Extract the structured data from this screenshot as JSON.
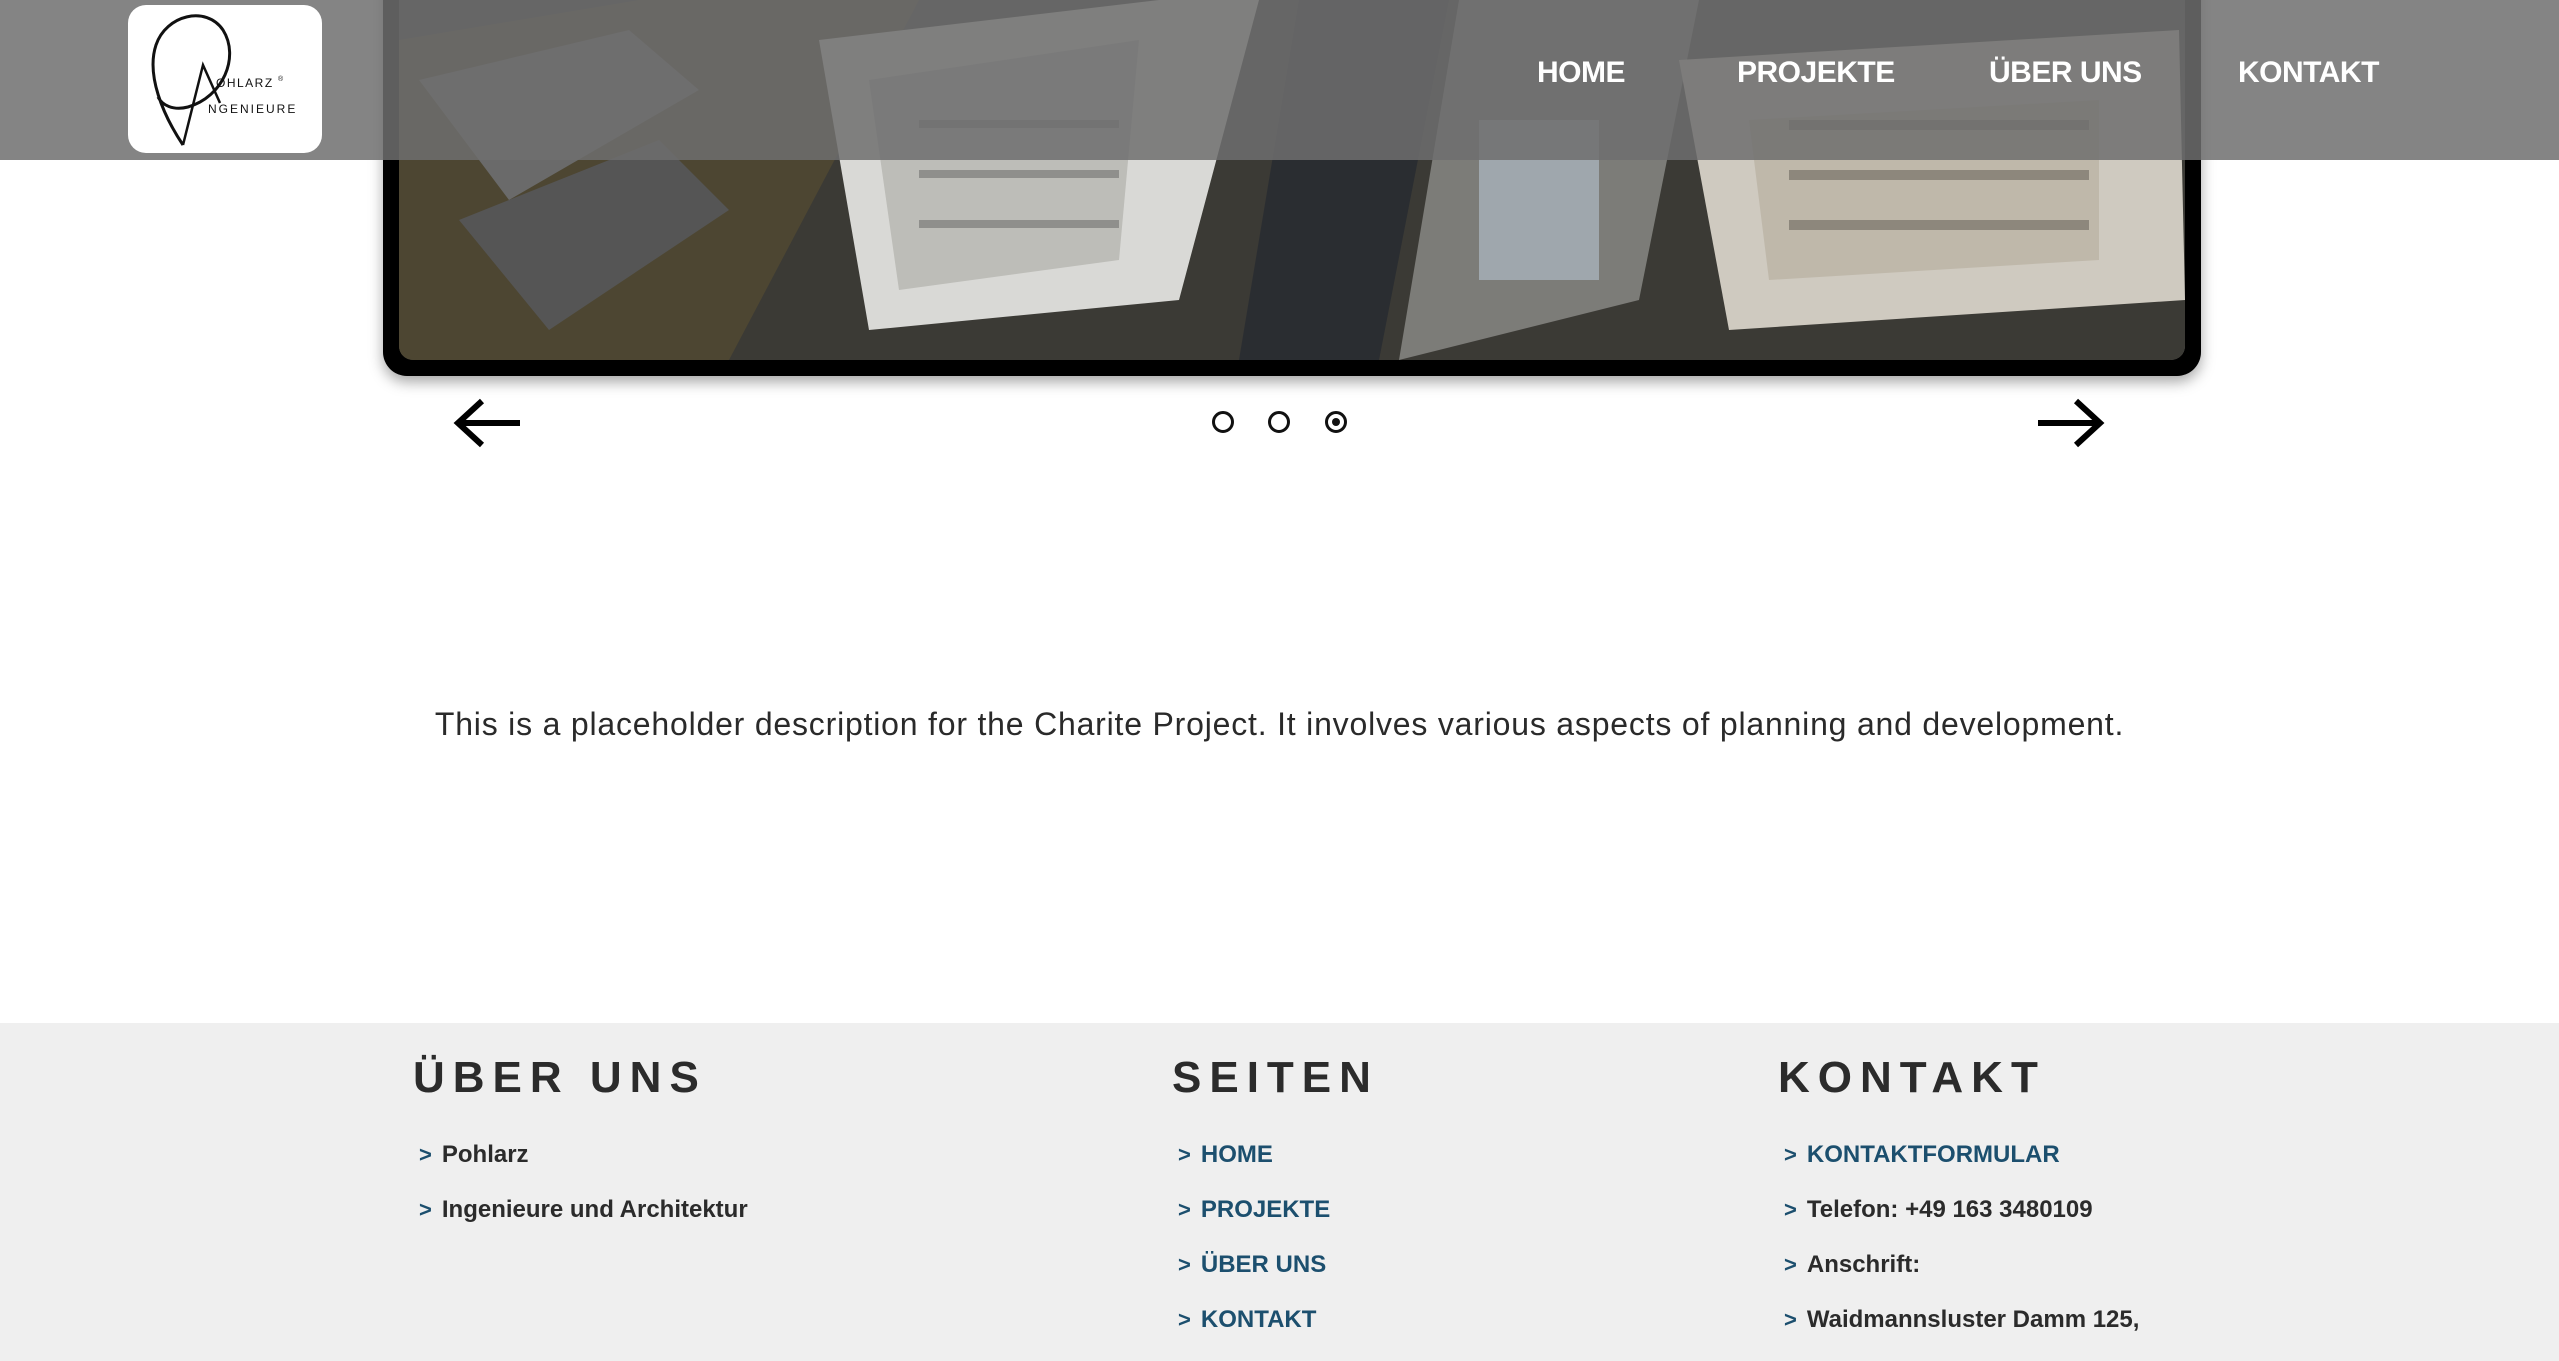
{
  "header": {
    "logo": {
      "text_top": "OHLARZ",
      "text_bottom": "NGENIEURE",
      "mark": "®"
    },
    "nav": [
      {
        "label": "HOME"
      },
      {
        "label": "PROJEKTE"
      },
      {
        "label": "ÜBER UNS"
      },
      {
        "label": "KONTAKT"
      }
    ],
    "background_color": "#6e6e6e"
  },
  "slider": {
    "prev_icon": "arrow-left-icon",
    "next_icon": "arrow-right-icon",
    "slide_count": 3,
    "active_slide": 3
  },
  "description": "This is a placeholder description for the Charite Project. It involves various aspects of planning and development.",
  "footer": {
    "background_color": "#efefef",
    "link_color": "#1c4f6e",
    "bullet": ">",
    "columns": [
      {
        "heading": "ÜBER UNS",
        "items": [
          {
            "label": "Pohlarz",
            "link": false
          },
          {
            "label": "Ingenieure und Architektur",
            "link": false
          }
        ]
      },
      {
        "heading": "SEITEN",
        "items": [
          {
            "label": "HOME",
            "link": true
          },
          {
            "label": "PROJEKTE",
            "link": true
          },
          {
            "label": "ÜBER UNS",
            "link": true
          },
          {
            "label": "KONTAKT",
            "link": true
          }
        ]
      },
      {
        "heading": "KONTAKT",
        "items": [
          {
            "label": "KONTAKTFORMULAR",
            "link": true
          },
          {
            "label": "Telefon: +49 163 3480109",
            "link": false
          },
          {
            "label": "Anschrift:",
            "link": false
          },
          {
            "label": "Waidmannsluster Damm 125,",
            "link": false
          }
        ]
      }
    ]
  }
}
